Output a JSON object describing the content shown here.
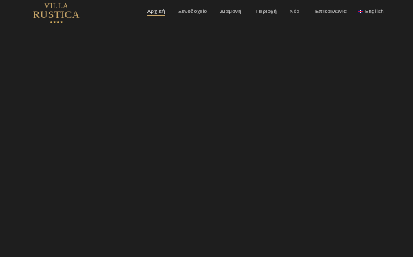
{
  "logo": {
    "line1": "VILLA",
    "line2": "RUSTICA",
    "stars": "★★★★"
  },
  "nav": {
    "items": [
      {
        "label": "Αρχική",
        "active": true
      },
      {
        "label": "Ξενοδοχείο",
        "active": false
      },
      {
        "label": "Διαμονή",
        "active": false
      },
      {
        "label": "Περιοχή",
        "active": false
      },
      {
        "label": "Νέα",
        "active": false
      },
      {
        "label": "Επικοινωνία",
        "active": false
      }
    ],
    "language": {
      "label": "English",
      "flag_icon": "uk-flag-icon"
    }
  },
  "colors": {
    "hero_background": "#1e1e1e",
    "accent_gold": "#c9a76a",
    "nav_text": "#d8d8d8",
    "page_background": "#ffffff"
  }
}
